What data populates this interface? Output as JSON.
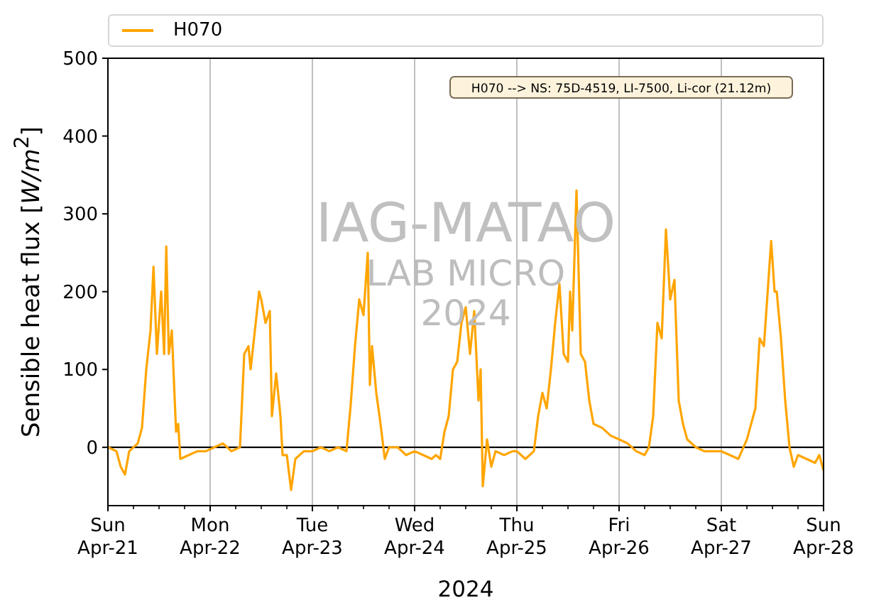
{
  "chart": {
    "chart_data": {
      "type": "line",
      "xlabel": "2024",
      "ylabel": "Sensible heat flux [*W/m*$^{2}$]",
      "xlim": [
        "2024-04-21T00:00",
        "2024-04-28T00:00"
      ],
      "ylim": [
        -75,
        500
      ],
      "yticks": [
        0,
        100,
        200,
        300,
        400,
        500
      ],
      "grid": "x",
      "xticks": [
        {
          "value": "2024-04-21T00:00",
          "label": "Sun\nApr-21"
        },
        {
          "value": "2024-04-22T00:00",
          "label": "Mon\nApr-22"
        },
        {
          "value": "2024-04-23T00:00",
          "label": "Tue\nApr-23"
        },
        {
          "value": "2024-04-24T00:00",
          "label": "Wed\nApr-24"
        },
        {
          "value": "2024-04-25T00:00",
          "label": "Thu\nApr-25"
        },
        {
          "value": "2024-04-26T00:00",
          "label": "Fri\nApr-26"
        },
        {
          "value": "2024-04-27T00:00",
          "label": "Sat\nApr-27"
        },
        {
          "value": "2024-04-28T00:00",
          "label": "Sun\nApr-28"
        }
      ],
      "x": [
        "2024-04-21T00:00",
        "2024-04-21T02:00",
        "2024-04-21T03:00",
        "2024-04-21T04:00",
        "2024-04-21T05:00",
        "2024-04-21T07:00",
        "2024-04-21T08:00",
        "2024-04-21T09:00",
        "2024-04-21T10:00",
        "2024-04-21T10:42",
        "2024-04-21T11:30",
        "2024-04-21T12:30",
        "2024-04-21T13:12",
        "2024-04-21T13:42",
        "2024-04-21T14:18",
        "2024-04-21T15:00",
        "2024-04-21T16:00",
        "2024-04-21T16:30",
        "2024-04-21T17:00",
        "2024-04-21T19:00",
        "2024-04-21T21:00",
        "2024-04-21T23:00",
        "2024-04-22T01:00",
        "2024-04-22T03:00",
        "2024-04-22T05:00",
        "2024-04-22T07:00",
        "2024-04-22T08:00",
        "2024-04-22T09:00",
        "2024-04-22T09:30",
        "2024-04-22T10:30",
        "2024-04-22T11:30",
        "2024-04-22T12:00",
        "2024-04-22T13:00",
        "2024-04-22T14:00",
        "2024-04-22T14:30",
        "2024-04-22T15:30",
        "2024-04-22T16:30",
        "2024-04-22T17:00",
        "2024-04-22T18:00",
        "2024-04-22T19:00",
        "2024-04-22T20:00",
        "2024-04-22T22:00",
        "2024-04-23T00:00",
        "2024-04-23T02:00",
        "2024-04-23T04:00",
        "2024-04-23T06:00",
        "2024-04-23T08:00",
        "2024-04-23T09:00",
        "2024-04-23T10:00",
        "2024-04-23T11:00",
        "2024-04-23T12:00",
        "2024-04-23T13:00",
        "2024-04-23T13:30",
        "2024-04-23T14:00",
        "2024-04-23T15:00",
        "2024-04-23T16:00",
        "2024-04-23T17:00",
        "2024-04-23T18:00",
        "2024-04-23T20:00",
        "2024-04-23T22:00",
        "2024-04-24T00:00",
        "2024-04-24T02:00",
        "2024-04-24T04:00",
        "2024-04-24T05:00",
        "2024-04-24T06:00",
        "2024-04-24T07:00",
        "2024-04-24T08:00",
        "2024-04-24T09:00",
        "2024-04-24T10:00",
        "2024-04-24T11:00",
        "2024-04-24T12:00",
        "2024-04-24T13:00",
        "2024-04-24T14:00",
        "2024-04-24T15:00",
        "2024-04-24T15:30",
        "2024-04-24T16:00",
        "2024-04-24T17:00",
        "2024-04-24T18:00",
        "2024-04-24T19:00",
        "2024-04-24T21:00",
        "2024-04-24T23:00",
        "2024-04-25T00:00",
        "2024-04-25T02:00",
        "2024-04-25T04:00",
        "2024-04-25T05:00",
        "2024-04-25T06:00",
        "2024-04-25T07:00",
        "2024-04-25T08:00",
        "2024-04-25T09:00",
        "2024-04-25T10:00",
        "2024-04-25T11:00",
        "2024-04-25T12:00",
        "2024-04-25T12:30",
        "2024-04-25T13:00",
        "2024-04-25T14:00",
        "2024-04-25T15:00",
        "2024-04-25T16:00",
        "2024-04-25T17:00",
        "2024-04-25T18:00",
        "2024-04-25T20:00",
        "2024-04-25T22:00",
        "2024-04-26T00:00",
        "2024-04-26T02:00",
        "2024-04-26T04:00",
        "2024-04-26T06:00",
        "2024-04-26T07:00",
        "2024-04-26T08:00",
        "2024-04-26T09:00",
        "2024-04-26T10:00",
        "2024-04-26T11:00",
        "2024-04-26T12:00",
        "2024-04-26T13:00",
        "2024-04-26T14:00",
        "2024-04-26T15:00",
        "2024-04-26T16:00",
        "2024-04-26T18:00",
        "2024-04-26T20:00",
        "2024-04-26T22:00",
        "2024-04-27T00:00",
        "2024-04-27T02:00",
        "2024-04-27T04:00",
        "2024-04-27T06:00",
        "2024-04-27T08:00",
        "2024-04-27T09:00",
        "2024-04-27T10:00",
        "2024-04-27T11:00",
        "2024-04-27T11:42",
        "2024-04-27T12:30",
        "2024-04-27T13:00",
        "2024-04-27T14:00",
        "2024-04-27T15:00",
        "2024-04-27T16:00",
        "2024-04-27T17:00",
        "2024-04-27T18:00",
        "2024-04-27T20:00",
        "2024-04-27T22:00",
        "2024-04-27T23:00",
        "2024-04-28T00:00"
      ],
      "series": [
        {
          "name": "H070",
          "color": "#ffa500",
          "values": [
            0,
            -5,
            -25,
            -35,
            -5,
            5,
            25,
            100,
            150,
            232,
            120,
            200,
            120,
            258,
            120,
            150,
            20,
            30,
            -15,
            -10,
            -5,
            -5,
            0,
            5,
            -5,
            0,
            120,
            130,
            100,
            150,
            200,
            190,
            160,
            175,
            40,
            95,
            40,
            -10,
            -10,
            -55,
            -15,
            -5,
            -5,
            0,
            -5,
            0,
            -5,
            55,
            130,
            190,
            170,
            250,
            80,
            130,
            70,
            30,
            -15,
            0,
            0,
            -10,
            -5,
            -10,
            -15,
            -10,
            -15,
            20,
            40,
            100,
            110,
            160,
            180,
            120,
            175,
            60,
            100,
            -50,
            10,
            -25,
            -5,
            -10,
            -5,
            -5,
            -15,
            -5,
            40,
            70,
            50,
            100,
            160,
            210,
            120,
            110,
            200,
            150,
            330,
            120,
            110,
            60,
            30,
            25,
            15,
            10,
            5,
            -5,
            -10,
            0,
            40,
            160,
            140,
            280,
            190,
            215,
            60,
            30,
            10,
            0,
            -5,
            -5,
            -5,
            -10,
            -15,
            10,
            50,
            140,
            130,
            210,
            265,
            200,
            200,
            140,
            60,
            0,
            -25,
            -10,
            -15,
            -20,
            -10,
            -30
          ]
        }
      ],
      "annotations": [
        {
          "text": "H070 --> NS: 75D-4519, LI-7500, Li-cor (21.12m)"
        }
      ]
    },
    "watermark": {
      "title": "IAG-MATAO",
      "lines": [
        "LAB MICRO",
        "2024"
      ]
    }
  }
}
